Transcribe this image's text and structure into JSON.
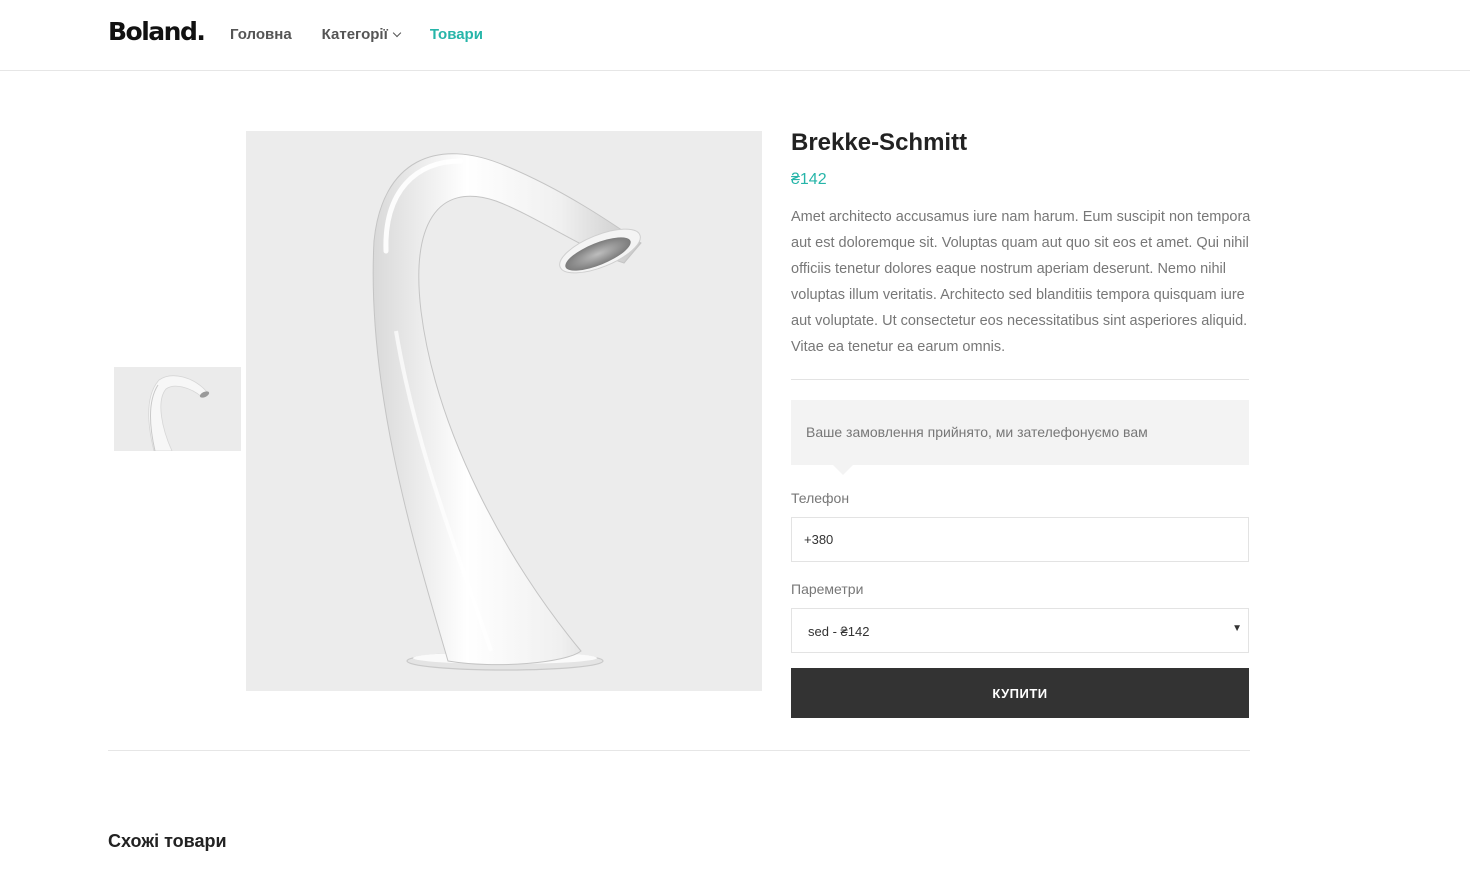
{
  "header": {
    "logo": "Boland.",
    "nav": [
      {
        "label": "Головна"
      },
      {
        "label": "Категорії"
      },
      {
        "label": "Товари"
      }
    ]
  },
  "product": {
    "title": "Brekke-Schmitt",
    "price": "₴142",
    "description": "Amet architecto accusamus iure nam harum. Eum suscipit non tempora aut est doloremque sit. Voluptas quam aut quo sit eos et amet. Qui nihil officiis tenetur dolores eaque nostrum aperiam deserunt. Nemo nihil voluptas illum veritatis. Architecto sed blanditiis tempora quisquam iure aut voluptate. Ut consectetur eos necessitatibus sint asperiores aliquid. Vitae ea tenetur ea earum omnis."
  },
  "order": {
    "notice": "Ваше замовлення прийнято, ми зателефонуємо вам",
    "phone_label": "Телефон",
    "phone_value": "+380",
    "params_label": "Пареметри",
    "params_selected": "sed - ₴142",
    "buy_label": "КУПИТИ"
  },
  "related": {
    "title": "Схожі товари"
  },
  "colors": {
    "accent": "#26b5a9",
    "button_bg": "#333333",
    "image_bg": "#ececec"
  },
  "icons": {
    "dropdown": "chevron-down-icon",
    "select_arrow": "triangle-down-icon"
  }
}
